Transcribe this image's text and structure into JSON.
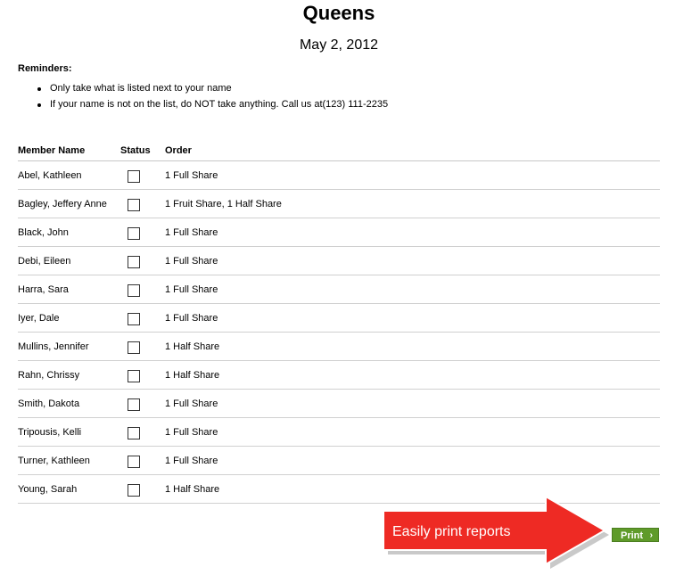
{
  "header": {
    "title": "Queens",
    "date": "May 2, 2012"
  },
  "reminders": {
    "heading": "Reminders:",
    "items": [
      "Only take what is listed next to your name",
      "If your name is not on the list, do NOT take anything. Call us at(123) 111-2235"
    ]
  },
  "table": {
    "columns": [
      "Member Name",
      "Status",
      "Order"
    ],
    "rows": [
      {
        "name": "Abel, Kathleen",
        "order": "1 Full Share",
        "checked": false
      },
      {
        "name": "Bagley, Jeffery Anne",
        "order": "1 Fruit Share, 1 Half Share",
        "checked": false
      },
      {
        "name": "Black, John",
        "order": "1 Full Share",
        "checked": false
      },
      {
        "name": "Debi, Eileen",
        "order": "1 Full Share",
        "checked": false
      },
      {
        "name": "Harra, Sara",
        "order": "1 Full Share",
        "checked": false
      },
      {
        "name": "Iyer, Dale",
        "order": "1 Full Share",
        "checked": false
      },
      {
        "name": "Mullins, Jennifer",
        "order": "1 Half Share",
        "checked": false
      },
      {
        "name": "Rahn, Chrissy",
        "order": "1 Half Share",
        "checked": false
      },
      {
        "name": "Smith, Dakota",
        "order": "1 Full Share",
        "checked": false
      },
      {
        "name": "Tripousis, Kelli",
        "order": "1 Full Share",
        "checked": false
      },
      {
        "name": "Turner, Kathleen",
        "order": "1 Full Share",
        "checked": false
      },
      {
        "name": "Young, Sarah",
        "order": "1 Half Share",
        "checked": false
      }
    ]
  },
  "callout": {
    "text": "Easily print reports",
    "color": "#ee2a24"
  },
  "print_button": {
    "label": "Print",
    "icon": "chevron-right-icon",
    "color": "#5f9b2a"
  }
}
